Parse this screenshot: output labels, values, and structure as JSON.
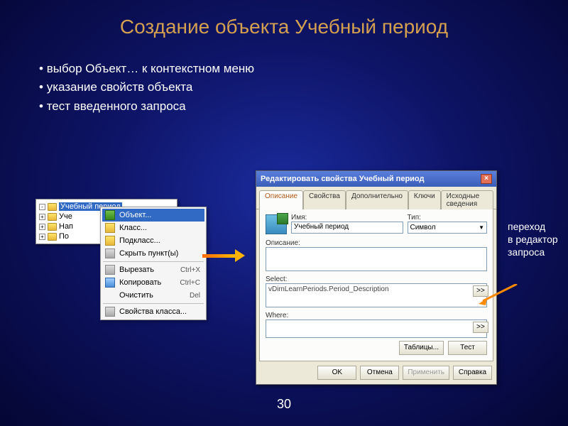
{
  "slide": {
    "title": "Создание объекта Учебный период",
    "bullets": [
      "выбор Объект… к контекстном меню",
      "указание свойств объекта",
      "тест введенного запроса"
    ],
    "page_number": "30"
  },
  "tree": {
    "items": [
      {
        "label": "Учебный период",
        "selected": true
      },
      {
        "label": "Уче"
      },
      {
        "label": "Нап"
      },
      {
        "label": "По"
      }
    ]
  },
  "context_menu": {
    "items": [
      {
        "label": "Объект...",
        "icon": "cube",
        "selected": true
      },
      {
        "label": "Класс...",
        "icon": "yellow"
      },
      {
        "label": "Подкласс...",
        "icon": "yellow"
      },
      {
        "label": "Скрыть пункт(ы)",
        "icon": "gray"
      },
      {
        "sep": true
      },
      {
        "label": "Вырезать",
        "shortcut": "Ctrl+X",
        "icon": "gray"
      },
      {
        "label": "Копировать",
        "shortcut": "Ctrl+C",
        "icon": "blue"
      },
      {
        "label": "Очистить",
        "shortcut": "Del",
        "icon": ""
      },
      {
        "sep": true
      },
      {
        "label": "Свойства класса...",
        "icon": "gray"
      }
    ]
  },
  "dialog": {
    "title": "Редактировать свойства Учебный период",
    "tabs": [
      "Описание",
      "Свойства",
      "Дополнительно",
      "Ключи",
      "Исходные сведения"
    ],
    "active_tab": 0,
    "labels": {
      "name": "Имя:",
      "type": "Тип:",
      "description": "Описание:",
      "select": "Select:",
      "where": "Where:"
    },
    "values": {
      "name": "Учебный период",
      "type": "Символ",
      "select": "vDimLearnPeriods.Period_Description",
      "where": ""
    },
    "side_btn": ">>",
    "inner_buttons": {
      "tables": "Таблицы...",
      "test": "Тест"
    },
    "buttons": {
      "ok": "OK",
      "cancel": "Отмена",
      "apply": "Применить",
      "help": "Справка"
    }
  },
  "annotation": {
    "lines": [
      "переход",
      "в редактор",
      "запроса"
    ]
  }
}
